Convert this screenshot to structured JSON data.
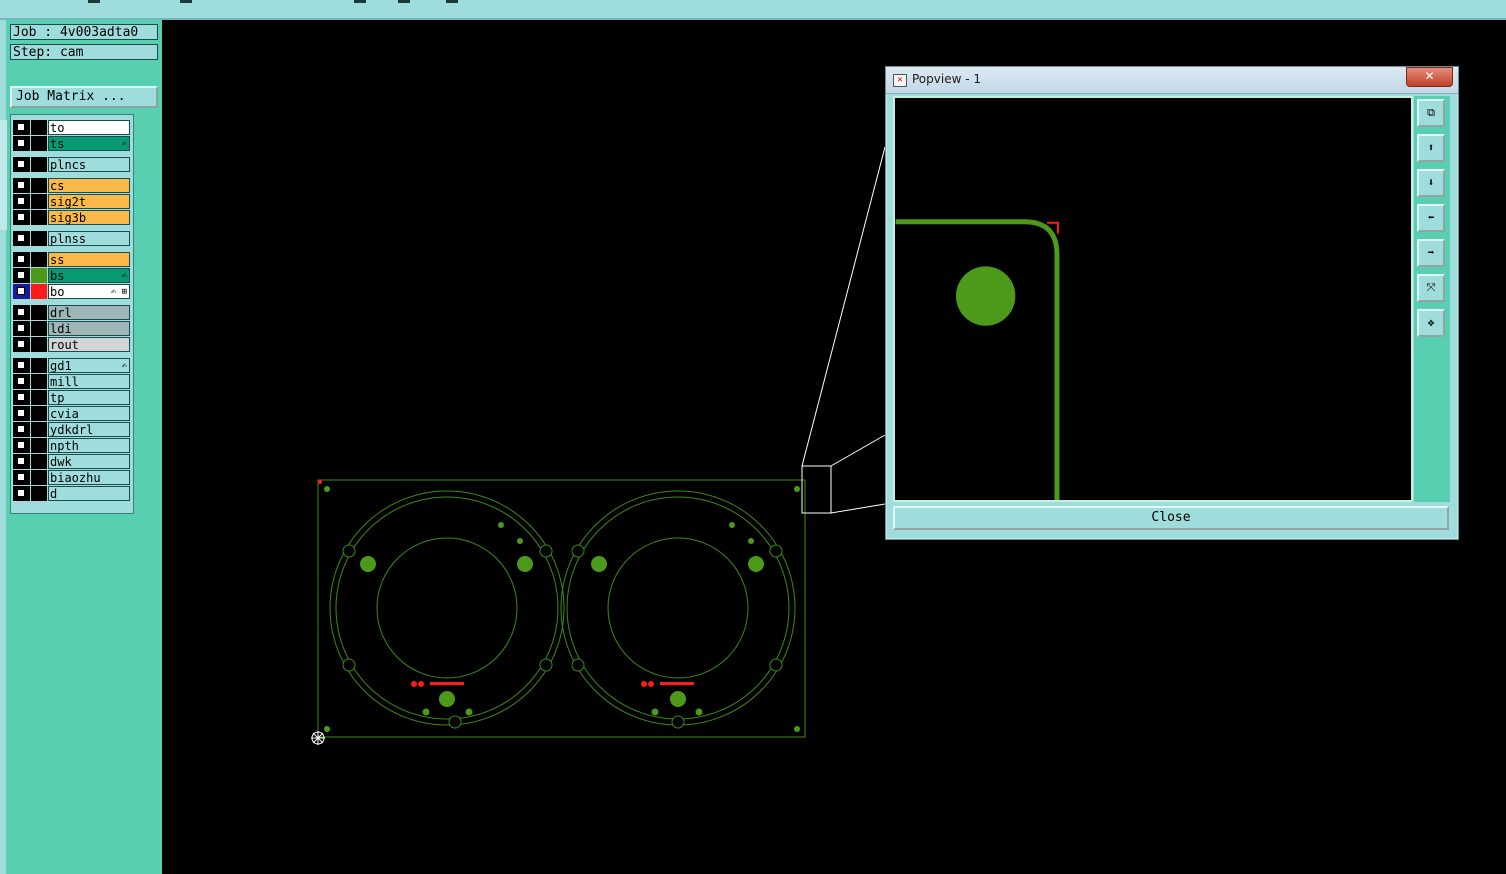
{
  "job_info": {
    "job_label": "Job : 4v003adta0",
    "step_label": "Step: cam",
    "job_matrix_button": "Job Matrix ..."
  },
  "layers": [
    {
      "name": "to",
      "color": "#ffffff",
      "swatch": "#000000",
      "icon": ""
    },
    {
      "name": "ts",
      "color": "#079a73",
      "swatch": "#000000",
      "icon": "✍"
    },
    {
      "name": "plncs",
      "color": "#9fdcdc",
      "swatch": "#000000",
      "icon": ""
    },
    {
      "name": "cs",
      "color": "#fbb94a",
      "swatch": "#000000",
      "icon": ""
    },
    {
      "name": "sig2t",
      "color": "#fbb94a",
      "swatch": "#000000",
      "icon": ""
    },
    {
      "name": "sig3b",
      "color": "#fbb94a",
      "swatch": "#000000",
      "icon": ""
    },
    {
      "name": "plnss",
      "color": "#9fdcdc",
      "swatch": "#000000",
      "icon": ""
    },
    {
      "name": "ss",
      "color": "#fbb94a",
      "swatch": "#000000",
      "icon": ""
    },
    {
      "name": "bs",
      "color": "#079a73",
      "swatch": "#4d9a1a",
      "icon": "✍"
    },
    {
      "name": "bo",
      "color": "#ffffff",
      "swatch": "#ff1b1b",
      "icon": "✍ ⊞"
    },
    {
      "name": "drl",
      "color": "#9fb6b8",
      "swatch": "#000000",
      "icon": ""
    },
    {
      "name": "ldi",
      "color": "#9fb6b8",
      "swatch": "#000000",
      "icon": ""
    },
    {
      "name": "rout",
      "color": "#d2d6d6",
      "swatch": "#000000",
      "icon": ""
    },
    {
      "name": "gd1",
      "color": "#9fdcdc",
      "swatch": "#000000",
      "icon": "✍"
    },
    {
      "name": "mill",
      "color": "#9fdcdc",
      "swatch": "#000000",
      "icon": ""
    },
    {
      "name": "tp",
      "color": "#9fdcdc",
      "swatch": "#000000",
      "icon": ""
    },
    {
      "name": "cvia",
      "color": "#9fdcdc",
      "swatch": "#000000",
      "icon": ""
    },
    {
      "name": "ydkdrl",
      "color": "#9fdcdc",
      "swatch": "#000000",
      "icon": ""
    },
    {
      "name": "npth",
      "color": "#9fdcdc",
      "swatch": "#000000",
      "icon": ""
    },
    {
      "name": "dwk",
      "color": "#9fdcdc",
      "swatch": "#000000",
      "icon": ""
    },
    {
      "name": "biaozhu",
      "color": "#9fdcdc",
      "swatch": "#000000",
      "icon": ""
    },
    {
      "name": "d",
      "color": "#9fdcdc",
      "swatch": "#000000",
      "icon": ""
    }
  ],
  "popup": {
    "title": "Popview - 1",
    "close_x": "✕",
    "close_button": "Close",
    "tools": [
      {
        "name": "zoom-home-icon",
        "glyph": "⧉"
      },
      {
        "name": "pan-up-icon",
        "glyph": "⬆"
      },
      {
        "name": "pan-down-icon",
        "glyph": "⬇"
      },
      {
        "name": "pan-left-icon",
        "glyph": "⬅"
      },
      {
        "name": "pan-right-icon",
        "glyph": "➡"
      },
      {
        "name": "zoom-fit-icon",
        "glyph": "⤧"
      },
      {
        "name": "zoom-out-icon",
        "glyph": "✥"
      }
    ]
  },
  "colors": {
    "panel": "#58cfb0",
    "panel_light": "#9fdcdc",
    "board": "#4d9a1a",
    "accent_red": "#ff1b1b",
    "background": "#000000"
  }
}
